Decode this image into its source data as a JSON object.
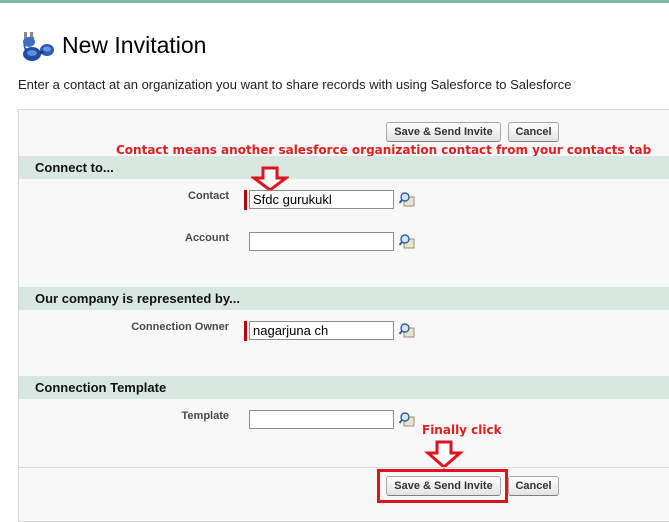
{
  "page": {
    "title": "New Invitation",
    "description": "Enter a contact at an organization you want to share records with using Salesforce to Salesforce"
  },
  "buttons": {
    "save_send": "Save & Send Invite",
    "cancel": "Cancel"
  },
  "sections": {
    "connect_to": "Connect to...",
    "our_company": "Our company is represented by...",
    "connection_template": "Connection Template"
  },
  "fields": {
    "contact": {
      "label": "Contact",
      "value": "Sfdc gurukukl"
    },
    "account": {
      "label": "Account",
      "value": ""
    },
    "connection_owner": {
      "label": "Connection Owner",
      "value": "nagarjuna ch"
    },
    "template": {
      "label": "Template",
      "value": ""
    }
  },
  "annotations": {
    "contact_note": "Contact means another salesforce organization contact from your contacts tab",
    "finally_click": "Finally click"
  },
  "colors": {
    "section_header_bg": "#d8e8e1",
    "required_bar": "#c00000",
    "annotation_red": "#e02020"
  }
}
